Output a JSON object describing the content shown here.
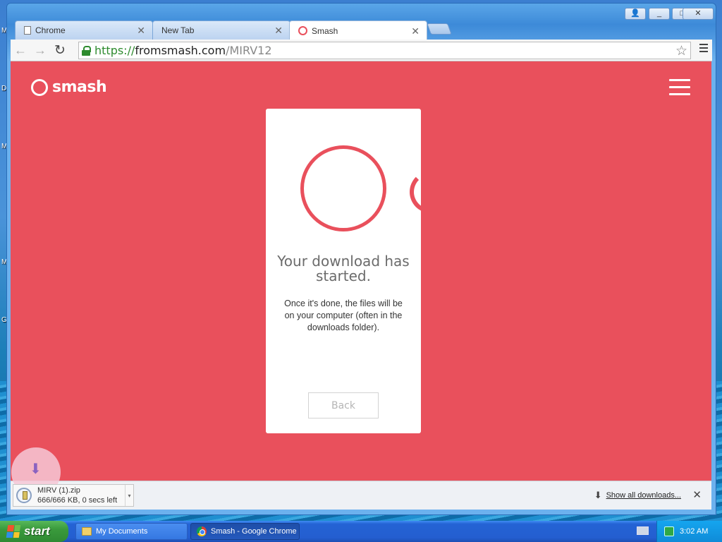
{
  "desktop": {
    "letters": [
      {
        "text": "M"
      },
      {
        "text": "D"
      },
      {
        "text": "M"
      },
      {
        "text": "M"
      },
      {
        "text": "G"
      }
    ]
  },
  "window": {
    "controls": {
      "user": "👤",
      "minimize": "_",
      "maximize": "□",
      "close": "✕"
    },
    "tabs": [
      {
        "title": "Chrome",
        "icon": "page-icon",
        "active": false
      },
      {
        "title": "New Tab",
        "icon": "none",
        "active": false
      },
      {
        "title": "Smash",
        "icon": "smash-icon",
        "active": true
      }
    ],
    "tab_close": "✕"
  },
  "toolbar": {
    "back": "←",
    "forward": "→",
    "reload": "↻",
    "url_scheme": "https://",
    "url_host": "fromsmash.com",
    "url_path": "/MIRV12",
    "star": "☆"
  },
  "page": {
    "brand": "smash",
    "accent_color": "#e9505c",
    "card": {
      "title": "Your download has started.",
      "text": "Once it's done, the files will be on your computer (often in the downloads folder).",
      "back_label": "Back"
    }
  },
  "download_shelf": {
    "file_name": "MIRV (1).zip",
    "status": "666/666 KB, 0 secs left",
    "caret": "▾",
    "show_all": "Show all downloads...",
    "show_all_icon": "⬇",
    "close": "✕",
    "arrow": "⬇"
  },
  "taskbar": {
    "start": "start",
    "buttons": [
      {
        "label": "My Documents",
        "icon": "folder-icon"
      },
      {
        "label": "Smash - Google Chrome",
        "icon": "chrome-icon"
      }
    ],
    "clock": "3:02 AM"
  }
}
